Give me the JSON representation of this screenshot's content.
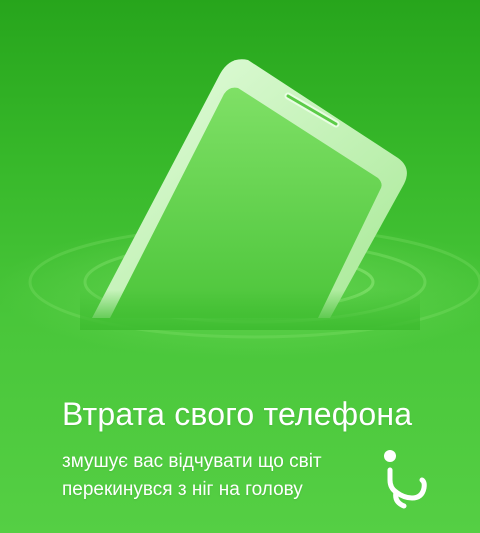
{
  "poster": {
    "headline": "Втрата свого телефона",
    "subline_1": "змушує вас відчувати що світ",
    "subline_2": "перекинувся з ніг на голову"
  },
  "icons": {
    "phone": "smartphone-sinking-icon",
    "ripples": "water-ripple-icon",
    "mark": "inverted-question-mark-icon"
  },
  "colors": {
    "background_top": "#27a51c",
    "background_bottom": "#55cf44",
    "phone_body": "#c8f5bc",
    "phone_screen": "#6fd95a",
    "text": "#ffffff"
  }
}
